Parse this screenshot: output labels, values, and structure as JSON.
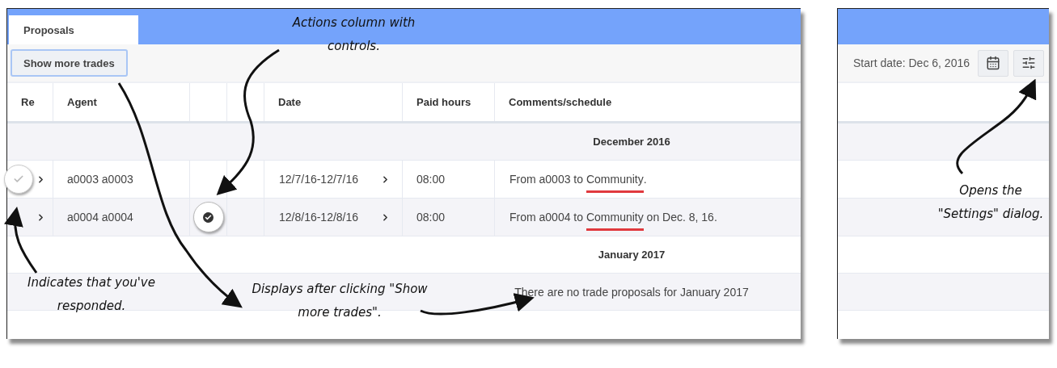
{
  "tab": {
    "label": "Proposals",
    "selected": true
  },
  "toolbar": {
    "show_more_button": "Show more trades",
    "start_date": "Start date: Dec 6, 2016"
  },
  "columns": [
    {
      "kind": "text",
      "label": "Re"
    },
    {
      "kind": "text",
      "label": "Agent"
    },
    {
      "kind": "blank"
    },
    {
      "kind": "blank"
    },
    {
      "kind": "text",
      "label": "Date"
    },
    {
      "kind": "text",
      "label": "Paid hours"
    },
    {
      "kind": "text",
      "label": "Comments/schedule"
    }
  ],
  "groups": [
    {
      "title": "December 2016",
      "rows": [
        {
          "responded": true,
          "agent": "a0003 a0003",
          "action": false,
          "date": "12/7/16-12/7/16",
          "paid_hours": "08:00",
          "comment": {
            "before": "From a0003 to ",
            "marked": "Community",
            "after": "."
          }
        },
        {
          "responded": false,
          "agent": "a0004 a0004",
          "action": true,
          "date": "12/8/16-12/8/16",
          "paid_hours": "08:00",
          "comment": {
            "before": "From a0004 to ",
            "marked": "Community",
            "after": " on Dec. 8, 16."
          }
        }
      ]
    },
    {
      "title": "January 2017",
      "empty_message": "There are no trade proposals for January 2017"
    }
  ],
  "annotations": [
    "Actions column with controls.",
    "Indicates that you've responded.",
    "Displays after clicking \"Show more trades\".",
    "Opens the \"Settings\" dialog."
  ]
}
